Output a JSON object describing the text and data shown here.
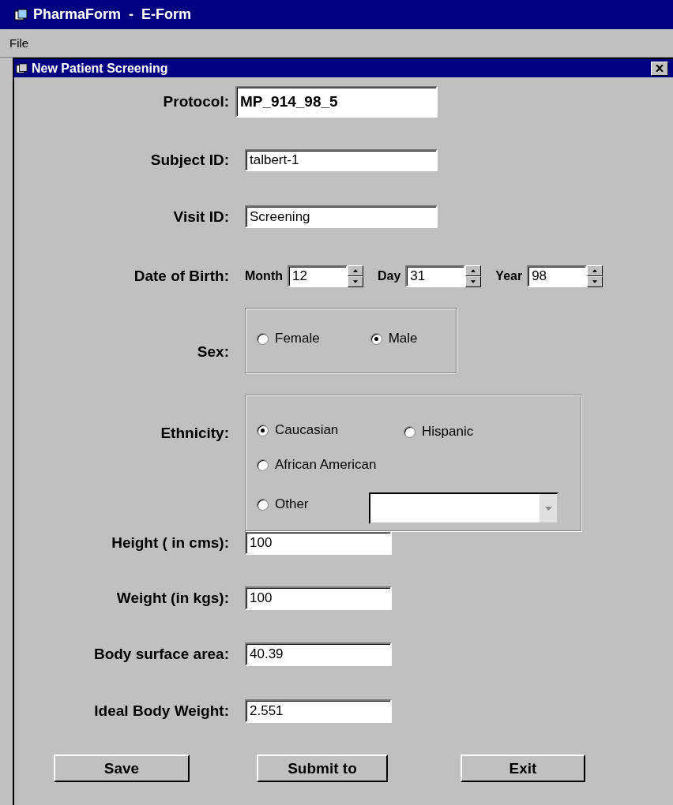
{
  "window": {
    "title": "PharmaForm  -  E-Form"
  },
  "menu": [
    "File"
  ],
  "dialog": {
    "title": "New Patient Screening"
  },
  "fields": [
    {
      "label": "Protocol:",
      "value": "MP_914_98_5",
      "kind": "large"
    },
    {
      "label": "Subject ID:",
      "value": "talbert-1",
      "kind": "text"
    },
    {
      "label": "Visit ID:",
      "value": "Screening",
      "kind": "text"
    }
  ],
  "date_of_birth": {
    "label": "Date of Birth:",
    "parts": [
      {
        "label": "Month",
        "value": "12"
      },
      {
        "label": "Day",
        "value": "31"
      },
      {
        "label": "Year",
        "value": "98"
      }
    ]
  },
  "sex": {
    "label": "Sex:",
    "options": [
      {
        "label": "Female",
        "selected": false
      },
      {
        "label": "Male",
        "selected": true
      }
    ]
  },
  "ethnicity": {
    "label": "Ethnicity:",
    "options": [
      {
        "label": "Caucasian",
        "selected": true
      },
      {
        "label": "Hispanic",
        "selected": false
      },
      {
        "label": "African American",
        "selected": false
      },
      {
        "label": "Other",
        "selected": false
      }
    ]
  },
  "measurements": [
    {
      "label": "Height ( in cms):",
      "value": "100"
    },
    {
      "label": "Weight (in kgs):",
      "value": "100"
    },
    {
      "label": "Body surface area:",
      "value": "40.39"
    },
    {
      "label": "Ideal Body Weight:",
      "value": "2.551"
    }
  ],
  "buttons": [
    "Save",
    "Submit to",
    "Exit"
  ]
}
